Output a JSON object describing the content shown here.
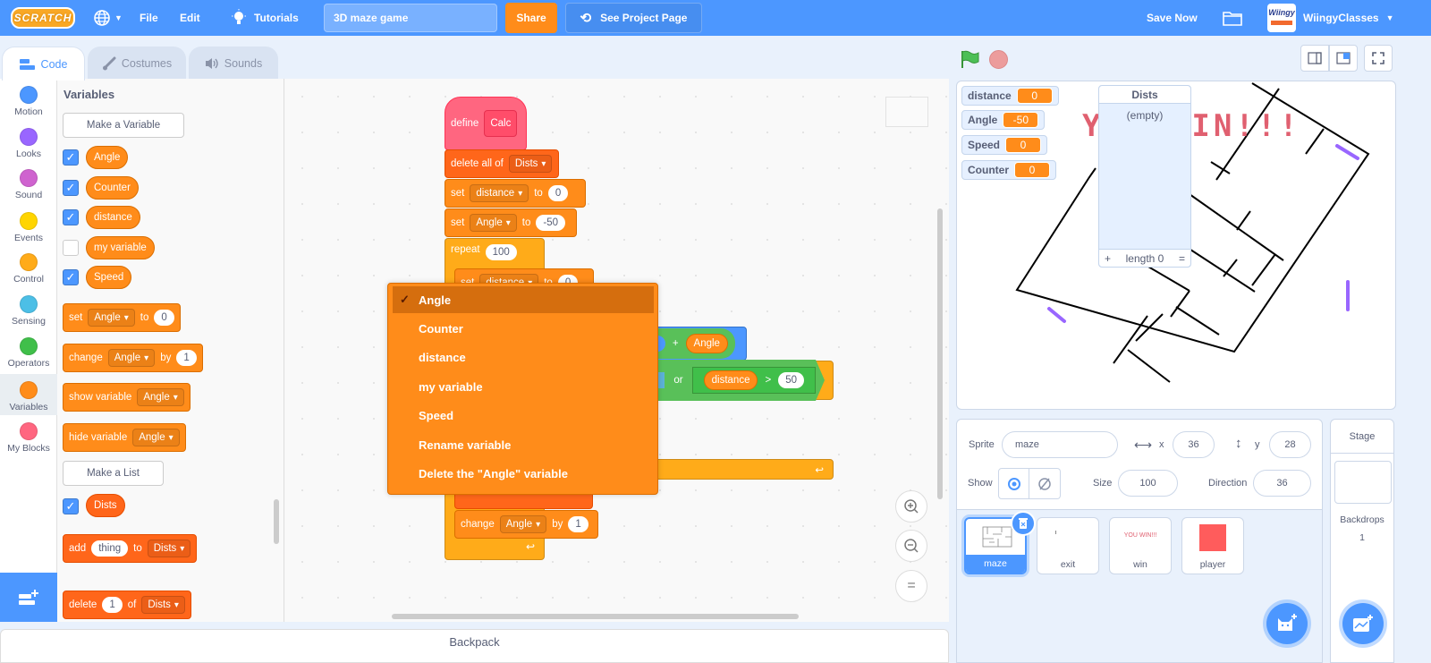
{
  "menubar": {
    "logo": "SCRATCH",
    "file": "File",
    "edit": "Edit",
    "tutorials": "Tutorials",
    "project_title": "3D maze game",
    "share": "Share",
    "see_project_page": "See Project Page",
    "save_now": "Save Now",
    "username": "WiingyClasses",
    "avatar_text": "Wiingy"
  },
  "tabs": [
    {
      "label": "Code",
      "active": true
    },
    {
      "label": "Costumes"
    },
    {
      "label": "Sounds"
    }
  ],
  "categories": [
    {
      "label": "Motion",
      "color": "#4c97ff"
    },
    {
      "label": "Looks",
      "color": "#9966ff"
    },
    {
      "label": "Sound",
      "color": "#cf63cf"
    },
    {
      "label": "Events",
      "color": "#ffd500"
    },
    {
      "label": "Control",
      "color": "#ffab19"
    },
    {
      "label": "Sensing",
      "color": "#4cbfe6"
    },
    {
      "label": "Operators",
      "color": "#40bf4a"
    },
    {
      "label": "Variables",
      "color": "#ff8c1a",
      "selected": true
    },
    {
      "label": "My Blocks",
      "color": "#ff6680"
    }
  ],
  "palette": {
    "title": "Variables",
    "make_variable": "Make a Variable",
    "variables": [
      {
        "name": "Angle",
        "checked": true
      },
      {
        "name": "Counter",
        "checked": true
      },
      {
        "name": "distance",
        "checked": true
      },
      {
        "name": "my variable",
        "checked": false
      },
      {
        "name": "Speed",
        "checked": true
      }
    ],
    "set_block": {
      "label": "set",
      "var": "Angle",
      "to": "to",
      "value": "0"
    },
    "change_block": {
      "label": "change",
      "var": "Angle",
      "by": "by",
      "value": "1"
    },
    "show_block": {
      "label": "show variable",
      "var": "Angle"
    },
    "hide_block": {
      "label": "hide variable",
      "var": "Angle"
    },
    "make_list": "Make a List",
    "lists": [
      {
        "name": "Dists",
        "checked": true
      }
    ],
    "add_block": {
      "label": "add",
      "value": "thing",
      "to": "to",
      "list": "Dists"
    },
    "delete_block": {
      "label": "delete",
      "value": "1",
      "of": "of",
      "list": "Dists"
    }
  },
  "script": {
    "define": "define",
    "define_name": "Calc",
    "delete_all": "delete all of",
    "delete_all_list": "Dists",
    "set1": {
      "label": "set",
      "var": "distance",
      "to": "to",
      "value": "0"
    },
    "set2": {
      "label": "set",
      "var": "Angle",
      "to": "to",
      "value": "-50"
    },
    "repeat": {
      "label": "repeat",
      "value": "100"
    },
    "set3": {
      "label": "set",
      "var": "distance",
      "to": "to",
      "value": "0"
    },
    "op_plus": "+",
    "op_angle": "Angle",
    "q": "?",
    "or": "or",
    "gt_var": "distance",
    "gt": ">",
    "gt_value": "50",
    "change": {
      "label": "change",
      "var": "Angle",
      "by": "by",
      "value": "1"
    }
  },
  "dropdown": {
    "items": [
      {
        "label": "Angle",
        "selected": true
      },
      {
        "label": "Counter"
      },
      {
        "label": "distance"
      },
      {
        "label": "my variable"
      },
      {
        "label": "Speed"
      },
      {
        "label": "Rename variable"
      },
      {
        "label": "Delete the \"Angle\" variable"
      }
    ],
    "checkmark": "✓"
  },
  "backpack": "Backpack",
  "stage": {
    "monitors": [
      {
        "name": "distance",
        "value": "0"
      },
      {
        "name": "Angle",
        "value": "-50"
      },
      {
        "name": "Speed",
        "value": "0"
      },
      {
        "name": "Counter",
        "value": "0"
      }
    ],
    "list_monitor": {
      "title": "Dists",
      "empty": "(empty)",
      "add": "+",
      "length": "length 0",
      "resize": "="
    },
    "banner_text": "YOU WIN!!!"
  },
  "sprite_info": {
    "sprite_label": "Sprite",
    "sprite_name": "maze",
    "x_label": "x",
    "x": "36",
    "y_label": "y",
    "y": "28",
    "show_label": "Show",
    "size_label": "Size",
    "size": "100",
    "direction_label": "Direction",
    "direction": "36"
  },
  "sprites": [
    {
      "name": "maze",
      "selected": true
    },
    {
      "name": "exit"
    },
    {
      "name": "win",
      "thumb_text": "YOU WIN!!!"
    },
    {
      "name": "player"
    }
  ],
  "stage_pane": {
    "title": "Stage",
    "backdrops_label": "Backdrops",
    "backdrops_count": "1"
  },
  "colors": {
    "accent": "#4c97ff",
    "variables": "#ff8c1a",
    "lists": "#ff661a",
    "control": "#ffab19",
    "operators": "#59c059",
    "myblocks": "#ff6680"
  }
}
